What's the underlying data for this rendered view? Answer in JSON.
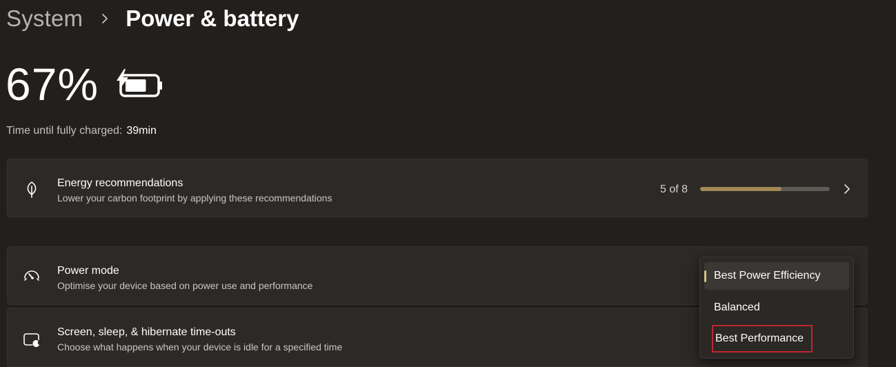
{
  "breadcrumb": {
    "parent": "System",
    "current": "Power & battery"
  },
  "battery": {
    "percent_label": "67%",
    "percent_value": 67,
    "charge_label": "Time until fully charged:",
    "charge_value": "39min",
    "icon": "battery-charging-icon"
  },
  "energy": {
    "icon": "leaf-icon",
    "title": "Energy recommendations",
    "subtitle": "Lower your carbon footprint by applying these recommendations",
    "progress_text": "5 of 8",
    "progress_fraction": 0.625,
    "progress_color": "#a48955",
    "chevron": "chevron-right-icon"
  },
  "power_mode": {
    "icon": "gauge-icon",
    "title": "Power mode",
    "subtitle": "Optimise your device based on power use and performance",
    "options": [
      {
        "label": "Best Power Efficiency",
        "selected": true
      },
      {
        "label": "Balanced",
        "selected": false
      },
      {
        "label": "Best Performance",
        "selected": false,
        "highlighted": true
      }
    ],
    "accent_color": "#d7c08a",
    "highlight_color": "#c0272d"
  },
  "screen_sleep": {
    "icon": "screen-sleep-icon",
    "title": "Screen, sleep, & hibernate time-outs",
    "subtitle": "Choose what happens when your device is idle for a specified time"
  }
}
